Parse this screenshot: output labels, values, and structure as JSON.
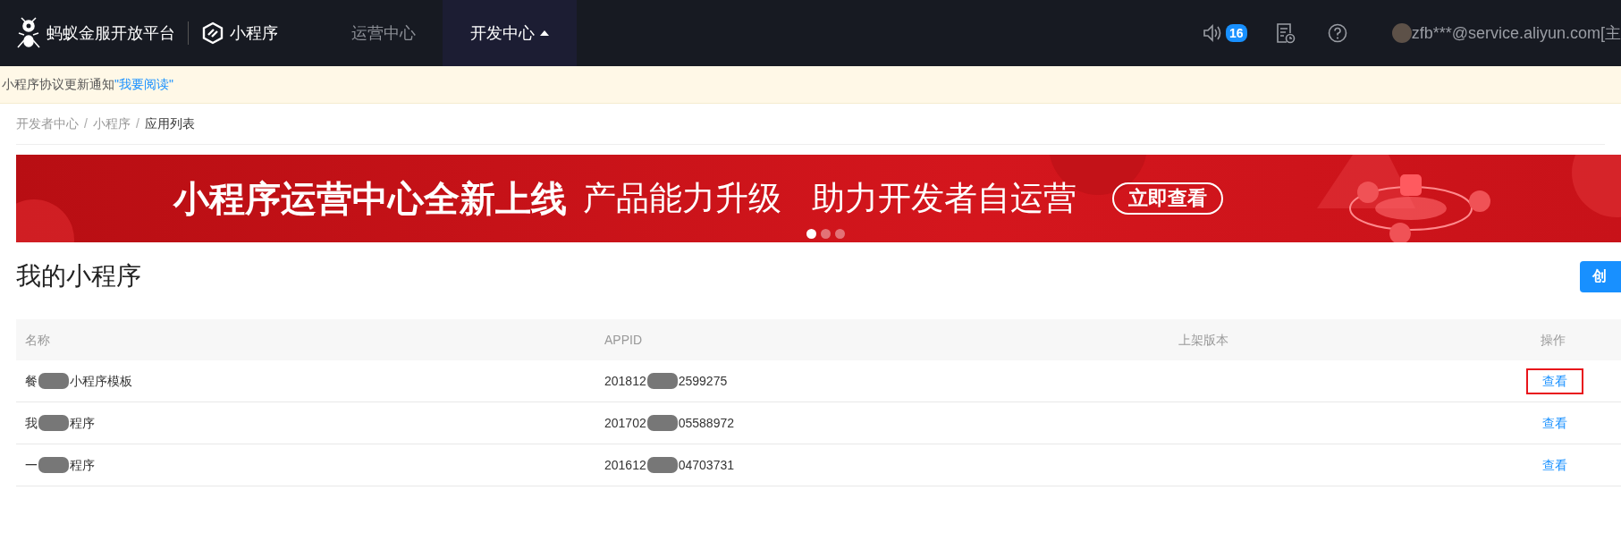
{
  "header": {
    "brand": "蚂蚁金服开放平台",
    "product": "小程序",
    "nav": [
      {
        "label": "运营中心",
        "selected": false
      },
      {
        "label": "开发中心",
        "selected": true
      }
    ],
    "notification_count": "16",
    "user": "zfb***@service.aliyun.com[主"
  },
  "notice": {
    "text": "小程序协议更新通知",
    "link": "\"我要阅读\""
  },
  "breadcrumb_separator": "/",
  "breadcrumb": [
    {
      "label": "开发者中心",
      "current": false
    },
    {
      "label": "小程序",
      "current": false
    },
    {
      "label": "应用列表",
      "current": true
    }
  ],
  "banner": {
    "headline": "小程序运营中心全新上线",
    "subline_1": "产品能力升级",
    "subline_2": "助力开发者自运营",
    "button": "立即查看",
    "dots": [
      {
        "selected": true
      },
      {
        "selected": false
      },
      {
        "selected": false
      }
    ]
  },
  "page_title": "我的小程序",
  "create_button": "创",
  "table": {
    "columns": [
      "名称",
      "APPID",
      "上架版本",
      "操作"
    ],
    "rows": [
      {
        "name": [
          "餐",
          "小程序模板"
        ],
        "appid": [
          "201812",
          "2599275"
        ],
        "action": "查看",
        "highlighted": true
      },
      {
        "name": [
          "我",
          "程序"
        ],
        "appid": [
          "201702",
          "05588972"
        ],
        "action": "查看",
        "highlighted": false
      },
      {
        "name": [
          "一",
          "程序"
        ],
        "appid": [
          "201612",
          "04703731"
        ],
        "action": "查看",
        "highlighted": false
      }
    ]
  }
}
